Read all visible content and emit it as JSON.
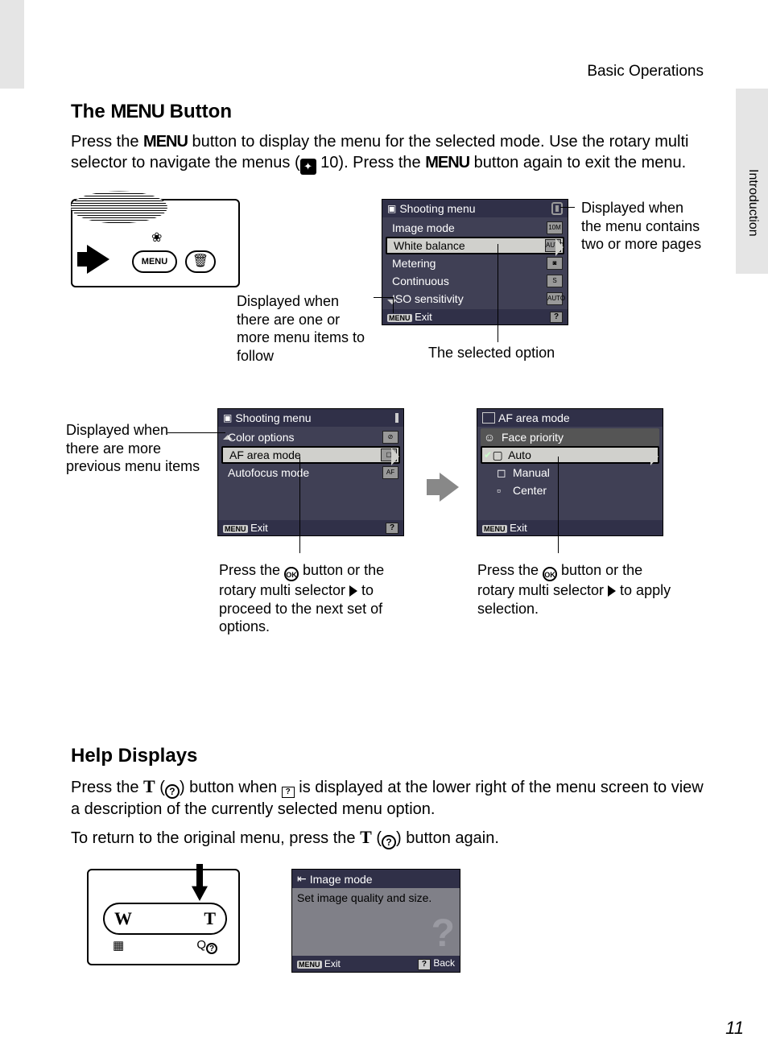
{
  "header": {
    "section": "Basic Operations",
    "side_tab": "Introduction",
    "page_number": "11"
  },
  "s1": {
    "title_pre": "The ",
    "title_menu": "MENU",
    "title_post": " Button",
    "para_1a": "Press the ",
    "para_1b": " button to display the menu for the selected mode. Use the rotary multi selector to navigate the menus (",
    "para_1c": " 10). Press the ",
    "para_1d": " button again to exit the menu."
  },
  "cam": {
    "menu_btn": "MENU"
  },
  "panel1": {
    "title": "Shooting menu",
    "items": {
      "0": {
        "label": "Image mode",
        "badge": "10M"
      },
      "1": {
        "label": "White balance",
        "badge": "AUTO"
      },
      "2": {
        "label": "Metering",
        "badge": "◙"
      },
      "3": {
        "label": "Continuous",
        "badge": "S"
      },
      "4": {
        "label": "ISO sensitivity",
        "badge": "AUTO"
      }
    },
    "exit": "Exit"
  },
  "panel2": {
    "title": "Shooting menu",
    "items": {
      "0": {
        "label": "Color options"
      },
      "1": {
        "label": "AF area mode"
      },
      "2": {
        "label": "Autofocus mode"
      }
    },
    "exit": "Exit"
  },
  "panel3": {
    "title": "AF area mode",
    "items": {
      "0": {
        "label": "Face priority"
      },
      "1": {
        "label": "Auto"
      },
      "2": {
        "label": "Manual"
      },
      "3": {
        "label": "Center"
      }
    },
    "exit": "Exit"
  },
  "callouts": {
    "pages": "Displayed when the menu contains two or more pages",
    "follow": "Displayed when there are one or more menu items to follow",
    "selected": "The selected option",
    "previous": "Displayed when there are more previous menu items",
    "next_a": "Press the ",
    "next_b": " button or the rotary multi selector ",
    "next_c": " to proceed to the next set of options.",
    "apply_a": "Press the ",
    "apply_b": " button or the rotary multi selector ",
    "apply_c": " to apply selection."
  },
  "s2": {
    "title": "Help Displays",
    "para1_a": "Press the ",
    "para1_T": "T",
    "para1_b": " (",
    "para1_c": ") button when ",
    "para1_d": " is displayed at the lower right of the menu screen to view a description of the currently selected menu option.",
    "para2_a": "To return to the original menu, press the ",
    "para2_b": " (",
    "para2_c": ") button again."
  },
  "zoom": {
    "W": "W",
    "T": "T"
  },
  "help_panel": {
    "title": "Image mode",
    "body": "Set image quality and size.",
    "exit": "Exit",
    "back": "Back"
  }
}
